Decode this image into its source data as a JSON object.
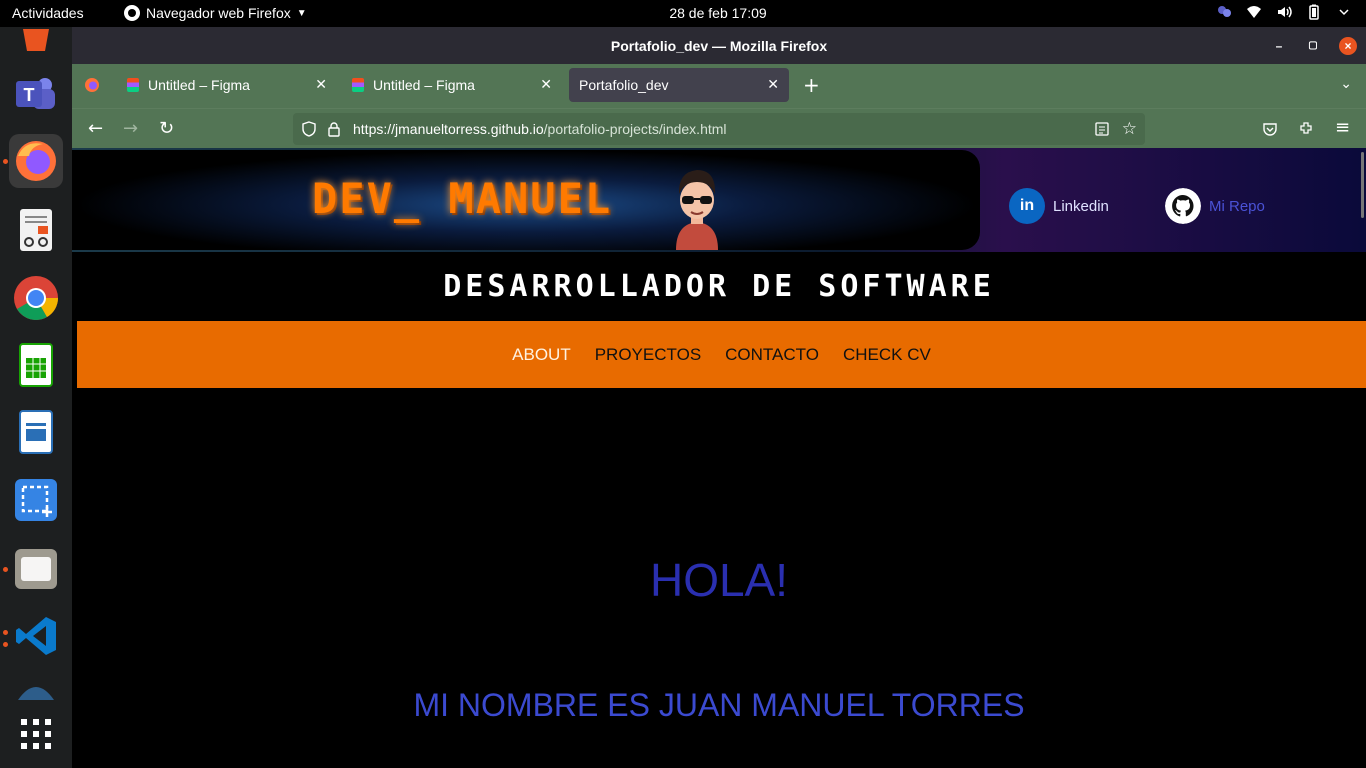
{
  "topbar": {
    "activities": "Actividades",
    "app_menu": "Navegador web Firefox",
    "clock": "28 de feb  17:09"
  },
  "window": {
    "title": "Portafolio_dev — Mozilla Firefox"
  },
  "tabs": [
    {
      "label": "Untitled – Figma"
    },
    {
      "label": "Untitled – Figma"
    },
    {
      "label": "Portafolio_dev"
    }
  ],
  "url": {
    "host": "https://jmanueltorress.github.io",
    "path": "/portafolio-projects/index.html"
  },
  "site": {
    "logo": "DEV_ MANUEL",
    "linkedin": "Linkedin",
    "repo": "Mi Repo",
    "subtitle": "DESARROLLADOR DE SOFTWARE",
    "menu": [
      "ABOUT",
      "PROYECTOS",
      "CONTACTO",
      "CHECK CV"
    ],
    "hola": "HOLA!",
    "nombre": "MI NOMBRE ES JUAN MANUEL TORRES"
  },
  "colors": {
    "accent_orange": "#e86b00",
    "firefox_chrome": "#537555",
    "hola_blue": "#2a2fb0"
  }
}
